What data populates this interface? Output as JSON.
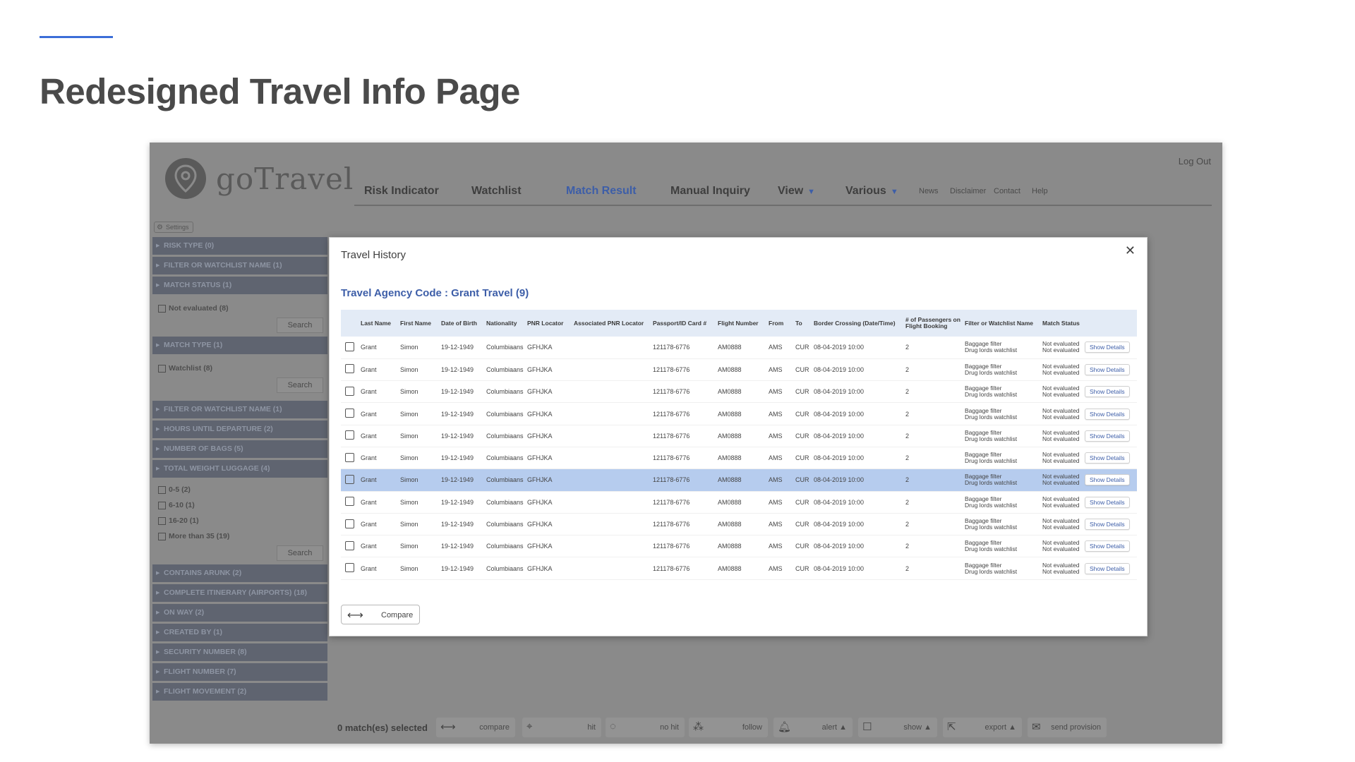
{
  "slide": {
    "title": "Redesigned Travel Info Page",
    "accent_color": "#3b6ed8"
  },
  "app": {
    "logo_text": "goTravel",
    "logout": "Log Out",
    "nav": [
      {
        "label": "Risk Indicator"
      },
      {
        "label": "Watchlist"
      },
      {
        "label": "Match Result",
        "active": true
      },
      {
        "label": "Manual Inquiry"
      },
      {
        "label": "View",
        "dropdown": true
      },
      {
        "label": "Various",
        "dropdown": true
      }
    ],
    "nav_small": [
      "News",
      "Disclaimer",
      "Contact",
      "Help"
    ],
    "settings": "Settings"
  },
  "sidebar": {
    "risk_type": "RISK TYPE (0)",
    "filter_watchlist_1": "FILTER OR WATCHLIST NAME (1)",
    "match_status": "MATCH STATUS (1)",
    "match_status_opt": "Not evaluated (8)",
    "search": "Search",
    "match_type": "MATCH TYPE (1)",
    "match_type_opt": "Watchlist (8)",
    "filter_watchlist_2": "FILTER OR WATCHLIST NAME (1)",
    "hours_until": "HOURS UNTIL DEPARTURE (2)",
    "num_bags": "NUMBER OF BAGS (5)",
    "total_weight": "TOTAL WEIGHT LUGGAGE (4)",
    "weight_opts": [
      "0-5 (2)",
      "6-10 (1)",
      "16-20 (1)",
      "More than 35 (19)"
    ],
    "contains_arunk": "CONTAINS ARUNK (2)",
    "complete_itinerary": "COMPLETE ITINERARY (AIRPORTS) (18)",
    "one_way": "ON WAY (2)",
    "created_by": "CREATED BY (1)",
    "security_number": "SECURITY NUMBER (8)",
    "flight_number": "FLIGHT NUMBER (7)",
    "flight_movement": "FLIGHT MOVEMENT (2)"
  },
  "bottom_bar": {
    "selected": "0 match(es) selected",
    "compare": "compare",
    "hit": "hit",
    "no_hit": "no hit",
    "follow": "follow",
    "alert": "alert ▲",
    "show": "show ▲",
    "export": "export ▲",
    "send_provision": "send provision"
  },
  "modal": {
    "title": "Travel History",
    "close": "✕",
    "agency": "Travel Agency Code : Grant Travel (9)",
    "columns": [
      "Last Name",
      "First Name",
      "Date of Birth",
      "Nationality",
      "PNR Locator",
      "Associated PNR Locator",
      "Passport/ID Card #",
      "Flight Number",
      "From",
      "To",
      "Border Crossing (Date/Time)",
      "# of Passengers on Flight Booking",
      "Filter or Watchlist Name",
      "Match Status",
      ""
    ],
    "row": {
      "last": "Grant",
      "first": "Simon",
      "dob": "19-12-1949",
      "nationality": "Columbiaans",
      "pnr": "GFHJKA",
      "assoc_pnr": "",
      "passport": "121178-6776",
      "flight": "AM0888",
      "from": "AMS",
      "to": "CUR",
      "border": "08-04-2019 10:00",
      "pax": "2",
      "filter_1": "Baggage filter",
      "filter_2": "Drug lords watchlist",
      "status_1": "Not evaluated",
      "status_2": "Not evaluated",
      "action": "Show Details"
    },
    "row_count": 11,
    "selected_row_index": 6,
    "compare": "Compare"
  }
}
